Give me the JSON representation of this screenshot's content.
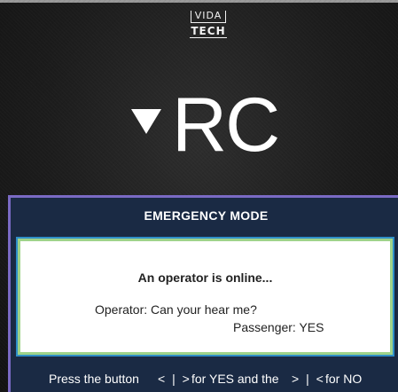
{
  "brand": {
    "logo_top": "VIDA",
    "logo_bottom": "TECH"
  },
  "drive_mode": {
    "icon": "triangle-down-icon",
    "code": "RC"
  },
  "emergency_panel": {
    "title": "EMERGENCY MODE",
    "status": "An operator is online...",
    "operator_message": "Operator: Can your hear me?",
    "passenger_message": "Passenger: YES"
  },
  "instructions": {
    "prefix": "Press the button",
    "yes_symbol": "< | >",
    "yes_text": "for YES and the",
    "no_symbol": "> | <",
    "no_text": "for NO"
  },
  "colors": {
    "panel_bg": "#1a2a44",
    "panel_border": "#7a6ac4",
    "message_border_inner": "#9fd38a",
    "message_border_outer": "#2f8fc8"
  }
}
